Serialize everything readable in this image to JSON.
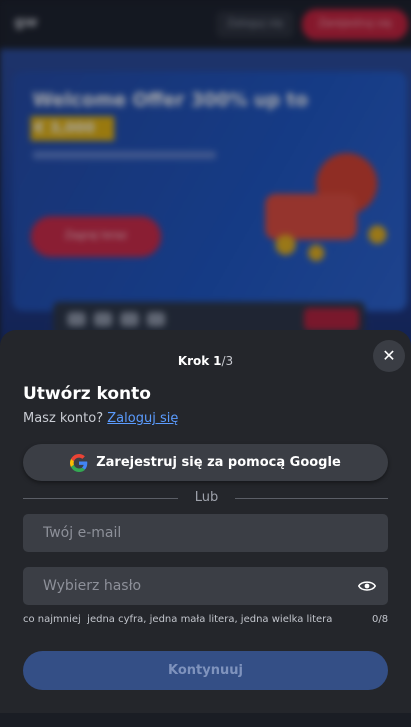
{
  "background": {
    "logo": "gw",
    "header_login": "Zaloguj się",
    "header_register": "Zarejestruj się",
    "hero_title": "Welcome Offer 300% up to",
    "hero_amount": "€ 3,000",
    "hero_cta": "Zagraj teraz"
  },
  "sheet": {
    "step_label": "Krok",
    "step_current": "1",
    "step_total": "/3",
    "close_symbol": "✕",
    "title": "Utwórz konto",
    "have_account_text": "Masz konto? ",
    "login_link": "Zaloguj się",
    "google_button": "Zarejestruj się za pomocą Google",
    "or_label": "Lub",
    "email_placeholder": "Twój e-mail",
    "password_placeholder": "Wybierz hasło",
    "password_hint": "co najmniej  jedna cyfra, jedna mała litera, jedna wielka litera",
    "password_counter": "0/8",
    "continue_button": "Kontynuuj"
  },
  "colors": {
    "sheet_bg": "#24262b",
    "input_bg": "#3b3e45",
    "link": "#5b9cff",
    "continue_disabled": "#344f86"
  }
}
